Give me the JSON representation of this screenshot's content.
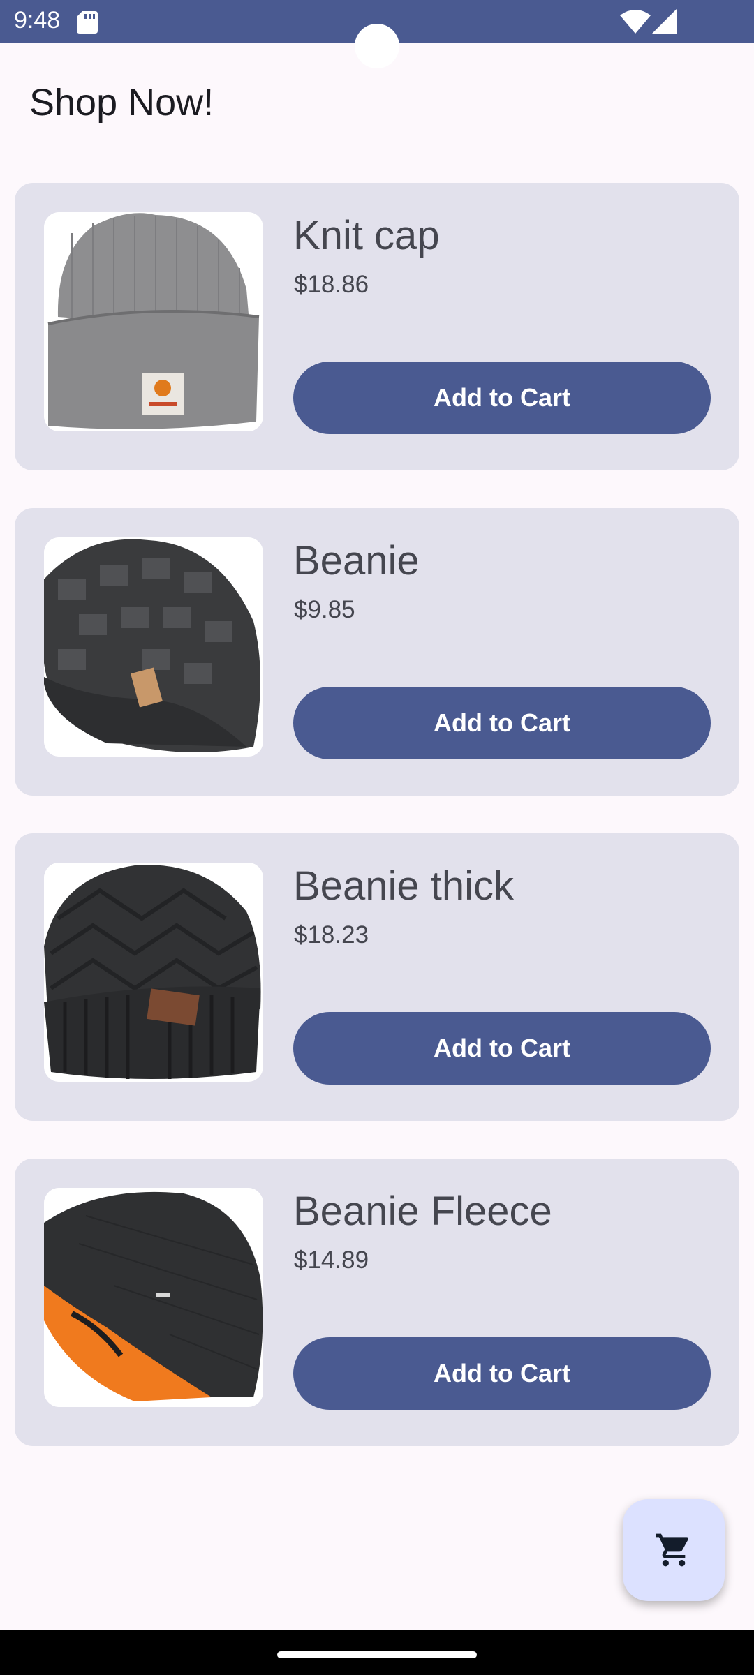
{
  "status_bar": {
    "time": "9:48",
    "icons": [
      "sd-card-icon",
      "wifi-icon",
      "signal-icon"
    ]
  },
  "page": {
    "title": "Shop Now!"
  },
  "products": [
    {
      "name": "Knit cap",
      "price": "$18.86",
      "button_label": "Add to Cart",
      "image": "grey-knit-cap-image"
    },
    {
      "name": "Beanie",
      "price": "$9.85",
      "button_label": "Add to Cart",
      "image": "dark-slouch-beanie-image"
    },
    {
      "name": "Beanie thick",
      "price": "$18.23",
      "button_label": "Add to Cart",
      "image": "black-cuffed-beanie-image"
    },
    {
      "name": "Beanie Fleece",
      "price": "$14.89",
      "button_label": "Add to Cart",
      "image": "black-orange-fleece-beanie-image"
    }
  ],
  "fab": {
    "icon": "shopping-cart-icon"
  },
  "colors": {
    "primary": "#4a5a91",
    "card_background": "#e2e1ec",
    "page_background": "#fdf8fc",
    "fab_background": "#dce1ff",
    "text": "#45464f"
  }
}
